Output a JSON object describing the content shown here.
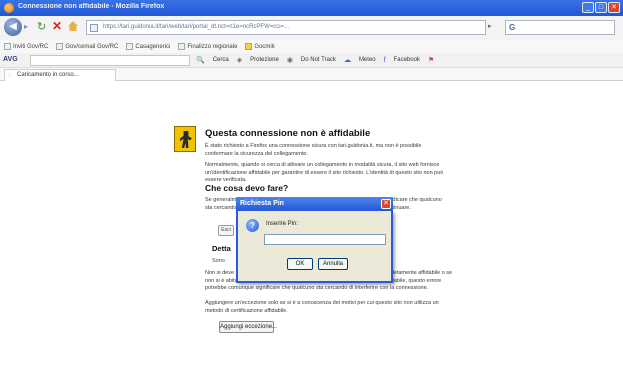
{
  "window": {
    "title": "Connessione non affidabile - Mozilla Firefox",
    "minimize": "_",
    "maximize": "□",
    "close": "✕"
  },
  "nav": {
    "back": "◀",
    "forward": "▸",
    "reload": "↻",
    "stop": "✕",
    "url": "https://tari.guidonia.it/tari/web/tari/portal_dt.nct=n1e=ncRcPFW=cci=...",
    "go": "▸",
    "search_engine": "G"
  },
  "bookmarks": [
    {
      "label": "Inviti Gov/RC",
      "icon": "page-icon"
    },
    {
      "label": "Gov/cemail Gov/RC",
      "icon": "page-icon"
    },
    {
      "label": "Casagenerici",
      "icon": "page-icon"
    },
    {
      "label": "Finalizzo regionale",
      "icon": "page-icon"
    },
    {
      "label": "Gocmik",
      "icon": "folder-icon"
    }
  ],
  "addon": {
    "logo": "AVG",
    "items": [
      "Cerca",
      "Protezione",
      "Do Not Track",
      "Meteo",
      "Facebook"
    ]
  },
  "tab": {
    "label": "Caricamento in corso..."
  },
  "page": {
    "title": "Questa connessione non è affidabile",
    "p1": "È stato richiesto a Firefox una connessione sicura con tari.guidonia.it, ma non è possibile confermare la sicurezza del collegamento.",
    "p2": "Normalmente, quando si cerca di attivare un collegamento in modalità sicura, il sito web fornisce un'identificazione affidabile per garantire di essere il sito richiesto. L'identità di questo sito non può essere verificata.",
    "section_heading": "Che cosa devo fare?",
    "p3": "Se generalmente ti connetti a questo sito senza problemi, l'errore potrebbe indicare che qualcuno sta cercando di falsificare l'identità del sito; in tal caso è consigliabile non continuare.",
    "stub_button": "Esci",
    "details_heading": "Detta",
    "details_line": "Sono",
    "p4": "Non si deve aggiungere un'eccezione se la connessione Internet non è completamente affidabile o se non si è abituati a visualizzare avvisi per questo server. Anche se il sito è affidabile, questo errore potrebbe comunque significare che qualcuno sta cercando di interferire con la connessione.",
    "p5": "Aggiungere un'eccezione solo se si è a conoscenza dei motivi per cui questo sito non utilizza un metodo di certificazione affidabile.",
    "exception_button": "Aggiungi eccezione..."
  },
  "dialog": {
    "title": "Richiesta Pin",
    "prompt": "Inserire Pin:",
    "input_value": "",
    "ok": "OK",
    "cancel": "Annulla",
    "close": "✕"
  }
}
